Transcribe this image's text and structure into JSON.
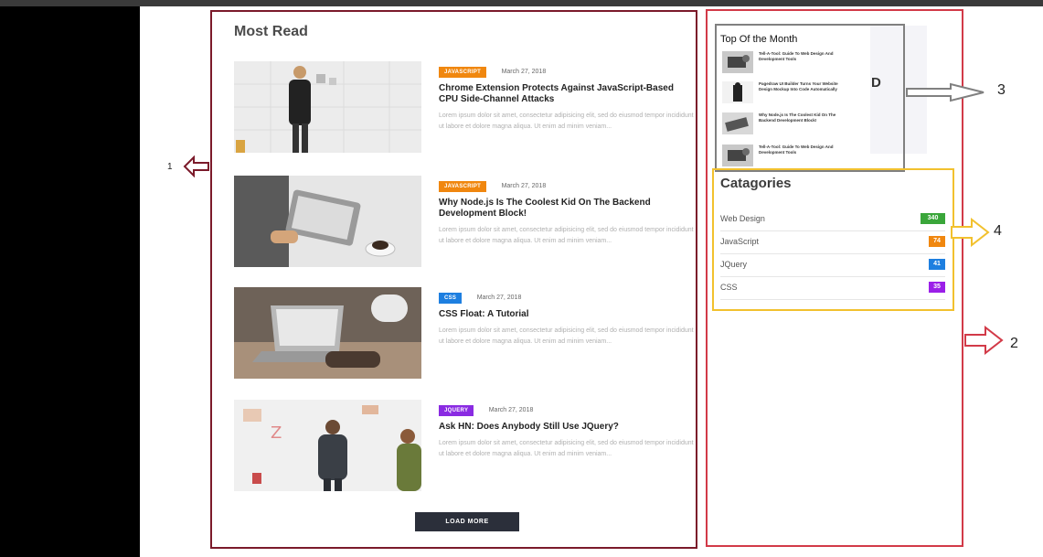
{
  "most_read": {
    "title": "Most Read",
    "articles": [
      {
        "tag": "JAVASCRIPT",
        "tag_color": "#f0870f",
        "date": "March 27, 2018",
        "title": "Chrome Extension Protects Against JavaScript-Based CPU Side-Channel Attacks",
        "excerpt": "Lorem ipsum dolor sit amet, consectetur adipisicing elit, sed do eiusmod tempor incididunt ut labore et dolore magna aliqua. Ut enim ad minim veniam..."
      },
      {
        "tag": "JAVASCRIPT",
        "tag_color": "#f0870f",
        "date": "March 27, 2018",
        "title": "Why Node.js Is The Coolest Kid On The Backend Development Block!",
        "excerpt": "Lorem ipsum dolor sit amet, consectetur adipisicing elit, sed do eiusmod tempor incididunt ut labore et dolore magna aliqua. Ut enim ad minim veniam..."
      },
      {
        "tag": "CSS",
        "tag_color": "#1e7fe0",
        "date": "March 27, 2018",
        "title": "CSS Float: A Tutorial",
        "excerpt": "Lorem ipsum dolor sit amet, consectetur adipisicing elit, sed do eiusmod tempor incididunt ut labore et dolore magna aliqua. Ut enim ad minim veniam..."
      },
      {
        "tag": "JQUERY",
        "tag_color": "#8a2be2",
        "date": "March 27, 2018",
        "title": "Ask HN: Does Anybody Still Use JQuery?",
        "excerpt": "Lorem ipsum dolor sit amet, consectetur adipisicing elit, sed do eiusmod tempor incididunt ut labore et dolore magna aliqua. Ut enim ad minim veniam..."
      }
    ],
    "load_more": "LOAD MORE"
  },
  "top_of_month": {
    "title": "Top Of the Month",
    "partial_letter": "D",
    "items": [
      {
        "title": "Tell-A-Tool: Guide To Web Design And Development Tools"
      },
      {
        "title": "Pagedraw UI Builder Turns Your Website Design Mockup Into Code Automatically"
      },
      {
        "title": "Why Node.js Is The Coolest Kid On The Backend Development Block!"
      },
      {
        "title": "Tell-A-Tool: Guide To Web Design And Development Tools"
      }
    ]
  },
  "categories": {
    "title": "Catagories",
    "items": [
      {
        "name": "Web Design",
        "count": "340",
        "color": "#3aa63a"
      },
      {
        "name": "JavaScript",
        "count": "74",
        "color": "#f0870f"
      },
      {
        "name": "JQuery",
        "count": "41",
        "color": "#1e7fe0"
      },
      {
        "name": "CSS",
        "count": "35",
        "color": "#9b1fe8"
      }
    ]
  },
  "annotations": {
    "label_1": "1",
    "label_2": "2",
    "label_3": "3",
    "label_4": "4"
  }
}
